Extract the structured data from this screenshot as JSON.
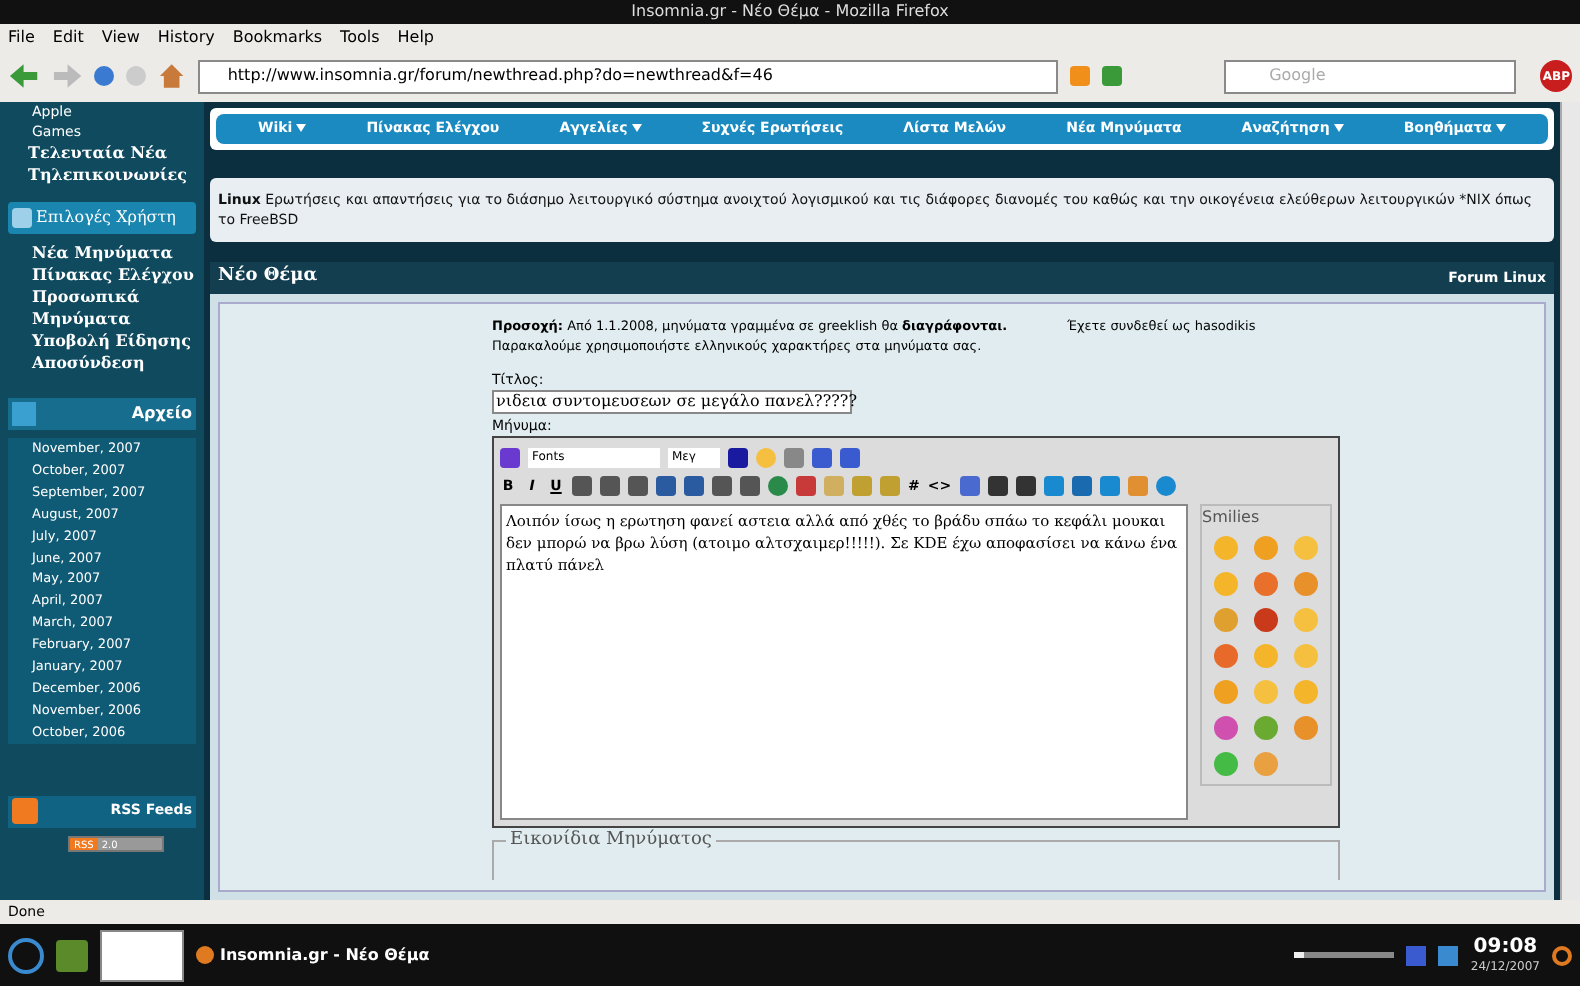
{
  "window": {
    "title": "Insomnia.gr - Νέο Θέμα - Mozilla Firefox"
  },
  "menu": [
    "File",
    "Edit",
    "View",
    "History",
    "Bookmarks",
    "Tools",
    "Help"
  ],
  "toolbar": {
    "url": "http://www.insomnia.gr/forum/newthread.php?do=newthread&f=46",
    "search_placeholder": "Google",
    "adblock_label": "ABP"
  },
  "sidebar": {
    "top_links": [
      {
        "label": "Apple",
        "kind": "small"
      },
      {
        "label": "Games",
        "kind": "small"
      },
      {
        "label": "Τελευταία Νέα",
        "kind": "big"
      },
      {
        "label": "Τηλεπικοινωνίες",
        "kind": "big"
      }
    ],
    "user_header": "Επιλογές Χρήστη",
    "user_items": [
      "Νέα Μηνύματα",
      "Πίνακας Ελέγχου",
      "Προσωπικά",
      "Μηνύματα",
      "Υποβολή Είδησης",
      "Αποσύνδεση"
    ],
    "archive_header": "Αρχείο",
    "archive_items": [
      "November, 2007",
      "October, 2007",
      "September, 2007",
      "August, 2007",
      "July, 2007",
      "June, 2007",
      "May, 2007",
      "April, 2007",
      "March, 2007",
      "February, 2007",
      "January, 2007",
      "December, 2006",
      "November, 2006",
      "October, 2006"
    ],
    "rss_header": "RSS Feeds",
    "rss_badge": [
      "RSS",
      "2.0"
    ]
  },
  "nav": [
    {
      "label": "Wiki",
      "dropdown": true
    },
    {
      "label": "Πίνακας Ελέγχου",
      "dropdown": false
    },
    {
      "label": "Αγγελίες",
      "dropdown": true
    },
    {
      "label": "Συχνές Ερωτήσεις",
      "dropdown": false
    },
    {
      "label": "Λίστα Μελών",
      "dropdown": false
    },
    {
      "label": "Νέα Μηνύματα",
      "dropdown": false
    },
    {
      "label": "Αναζήτηση",
      "dropdown": true
    },
    {
      "label": "Βοηθήματα",
      "dropdown": true
    }
  ],
  "forum_description": "**Linux** Ερωτήσεις και απαντήσεις για το διάσημο λειτουργικό σύστημα ανοιχτού λογισμικού και τις διάφορες διανομές του καθώς και την οικογένεια ελεύθερων λειτουργικών *NIX όπως το FreeBSD",
  "panel": {
    "title": "Νέο Θέμα",
    "forum_link": "Forum Linux",
    "notice": [
      "**Προσοχή:** Από 1.1.2008, μηνύματα γραμμένα σε greeklish θα **διαγράφονται.**",
      "Παρακαλούμε χρησιμοποιήστε ελληνικούς χαρακτήρες στα μηνύματα σας."
    ],
    "logged_in": "Έχετε συνδεθεί ως hasodikis",
    "title_label": "Τίτλος:",
    "title_value": "νιδεια συντομευσεων σε μεγάλο πανελ?????",
    "message_label": "Μήνυμα:",
    "font_select": "Fonts",
    "size_select": "Μεγ",
    "format_buttons": [
      "B",
      "I",
      "U"
    ],
    "code_buttons": [
      "#",
      "<>"
    ],
    "message_value": "Λοιπόν ίσως η ερωτηση φανεί αστεια αλλά από χθές το βράδυ σπάω το κεφάλι μουκαι δεν μπορώ να βρω λύση (ατοιμο αλτσχαιμερ!!!!!). Σε KDE έχω αποφασίσει να κάνω ένα πλατύ πάνελ",
    "smilies_title": "Smilies",
    "smilies": [
      {
        "color": "#f5b52a"
      },
      {
        "color": "#f0a020"
      },
      {
        "color": "#f5c040"
      },
      {
        "color": "#f5b52a"
      },
      {
        "color": "#e8702a"
      },
      {
        "color": "#e8902a"
      },
      {
        "color": "#e0a030"
      },
      {
        "color": "#c83a1a"
      },
      {
        "color": "#f5c040"
      },
      {
        "color": "#e86a2a"
      },
      {
        "color": "#f5b52a"
      },
      {
        "color": "#f5c040"
      },
      {
        "color": "#f0a020"
      },
      {
        "color": "#f5c040"
      },
      {
        "color": "#f5b52a"
      },
      {
        "color": "#d050b0"
      },
      {
        "color": "#6aaa30"
      },
      {
        "color": "#e8902a"
      },
      {
        "color": "#44bb44"
      },
      {
        "color": "#e8a040"
      }
    ],
    "icons_legend": "Εικονίδια Μηνύματος"
  },
  "status_bar": "Done",
  "taskbar": {
    "task": "Insomnia.gr - Νέο Θέμα",
    "volume": {
      "level": 0.1
    },
    "time": "09:08",
    "date": "24/12/2007"
  }
}
